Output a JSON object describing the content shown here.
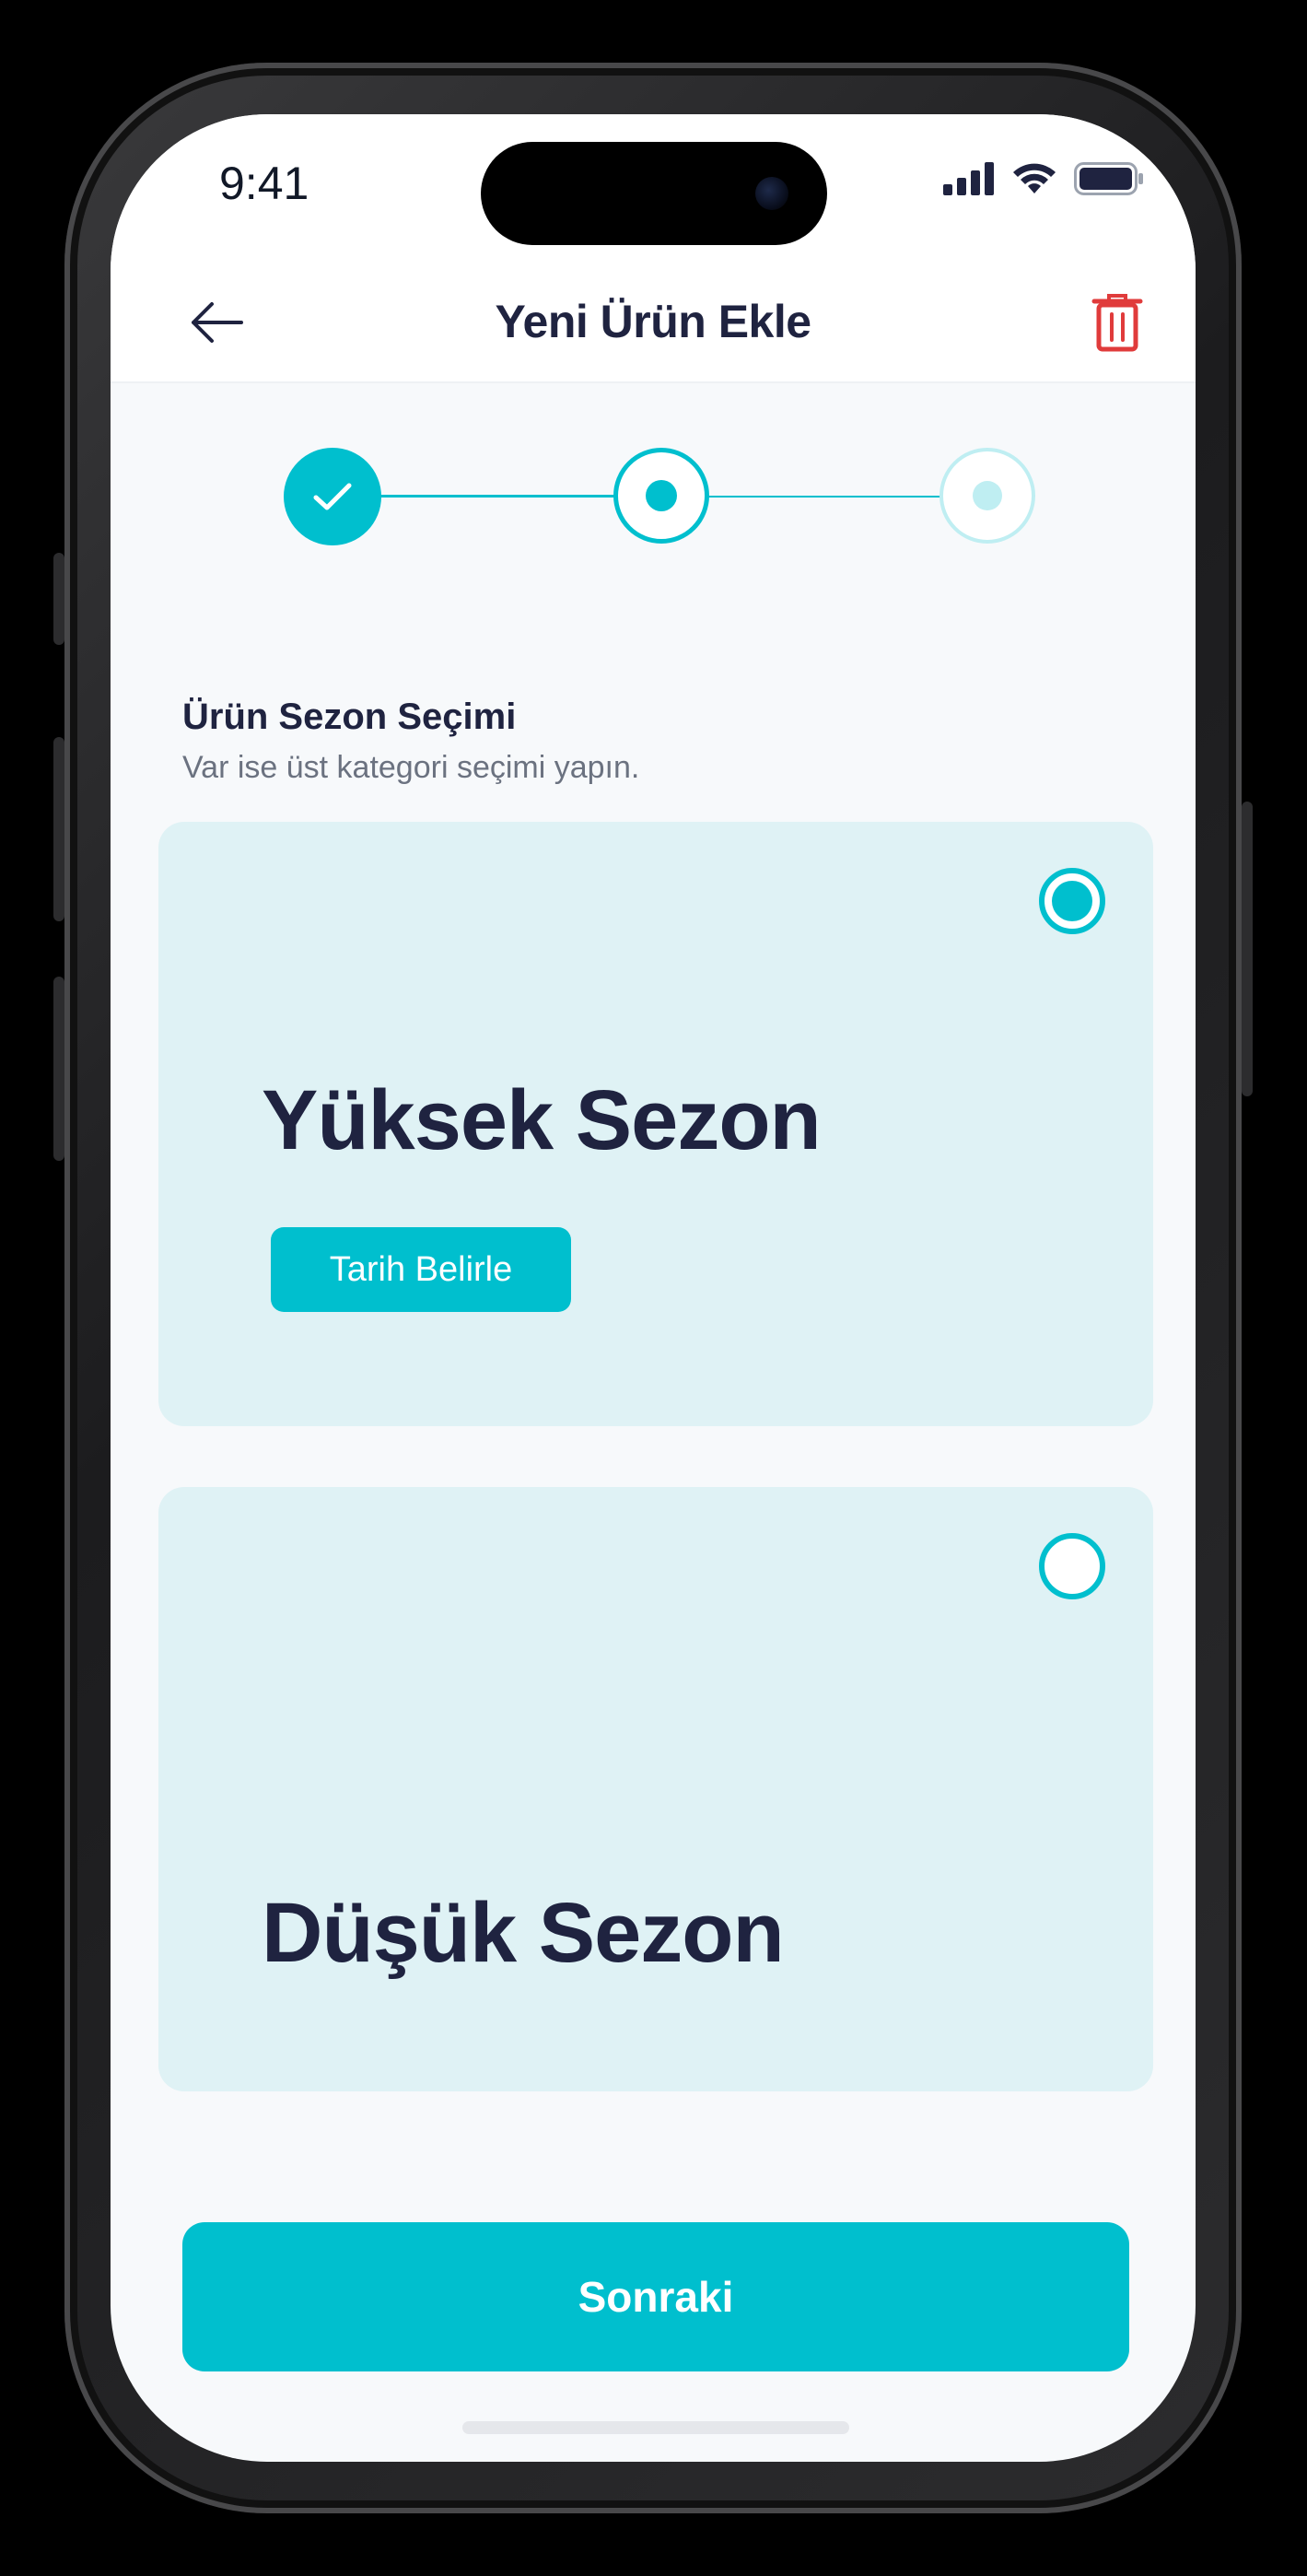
{
  "status_bar": {
    "time": "9:41",
    "icons": [
      "signal-icon",
      "wifi-icon",
      "battery-icon"
    ]
  },
  "header": {
    "title": "Yeni Ürün Ekle",
    "back_icon": "arrow-left-icon",
    "delete_icon": "trash-icon"
  },
  "stepper": {
    "steps": [
      {
        "state": "completed",
        "icon": "check-icon"
      },
      {
        "state": "current"
      },
      {
        "state": "upcoming"
      }
    ]
  },
  "section": {
    "title": "Ürün Sezon Seçimi",
    "subtitle": "Var ise üst kategori seçimi yapın."
  },
  "options": [
    {
      "title": "Yüksek Sezon",
      "selected": true,
      "button_label": "Tarih Belirle"
    },
    {
      "title": "Düşük Sezon",
      "selected": false
    }
  ],
  "footer": {
    "next_label": "Sonraki"
  },
  "colors": {
    "accent": "#00BFCE",
    "card_bg": "#DFF2F5",
    "title_text": "#1F2340",
    "danger": "#E03B3B",
    "screen_bg": "#F7F9FB"
  }
}
